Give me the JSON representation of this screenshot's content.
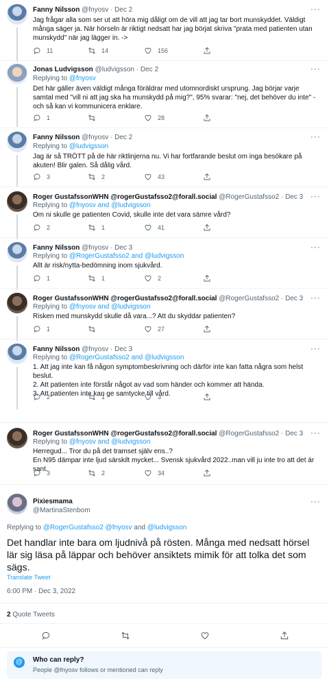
{
  "tweets": [
    {
      "name": "Fanny Nilsson",
      "handle": "@fnyosv",
      "date": "Dec 2",
      "replying": null,
      "text": "Jag frågar alla som ser ut att höra mig dåligt om de vill att jag tar bort munskyddet. Väldigt många säger ja. När hörseln är riktigt nedsatt har jag börjat skriva \"prata med patienten utan munskydd\" när jag lägger in. ->",
      "replies": "11",
      "retweets": "14",
      "likes": "156"
    },
    {
      "name": "Jonas Ludvigsson",
      "handle": "@ludvigsson",
      "date": "Dec 2",
      "replying": [
        "@fnyosv"
      ],
      "text": "Det här gäller även väldigt många föräldrar med utomnordiskt ursprung. Jag börjar varje samtal med \"vill ni att jag ska ha munskydd på mig?\", 95% svarar: \"nej, det behöver du inte\" - och så kan vi kommunicera enklare.",
      "replies": "1",
      "retweets": "",
      "likes": "28"
    },
    {
      "name": "Fanny Nilsson",
      "handle": "@fnyosv",
      "date": "Dec 2",
      "replying": [
        "@ludvigsson"
      ],
      "text": "Jag är så TRÖTT på de här riktlinjerna nu. Vi har fortfarande beslut om inga besökare på akuten! Blir galen. Så dålig vård.",
      "replies": "3",
      "retweets": "2",
      "likes": "43"
    },
    {
      "name": "Roger GustafssonWHN @rogerGustafsso2@forall.social",
      "handle": "@RogerGustafsso2",
      "date": "Dec 3",
      "replying": [
        "@fnyosv",
        "@ludvigsson"
      ],
      "text": "Om ni skulle ge patienten Covid, skulle inte det vara sämre vård?",
      "replies": "2",
      "retweets": "1",
      "likes": "41"
    },
    {
      "name": "Fanny Nilsson",
      "handle": "@fnyosv",
      "date": "Dec 3",
      "replying": [
        "@RogerGustafsso2",
        "@ludvigsson"
      ],
      "text": "Allt är risk/nytta-bedömning inom sjukvård.",
      "replies": "1",
      "retweets": "1",
      "likes": "2"
    },
    {
      "name": "Roger GustafssonWHN @rogerGustafsso2@forall.social",
      "handle": "@RogerGustafsso2",
      "date": "Dec 3",
      "replying": [
        "@fnyosv",
        "@ludvigsson"
      ],
      "text": "Risken med munskydd skulle då vara...? Att du skyddar patienten?",
      "replies": "1",
      "retweets": "",
      "likes": "27"
    },
    {
      "name": "Fanny Nilsson",
      "handle": "@fnyosv",
      "date": "Dec 3",
      "replying": [
        "@RogerGustafsso2",
        "@ludvigsson"
      ],
      "text_lines": [
        "1. Att jag inte kan få någon symptombeskrivning och därför inte kan fatta några som helst beslut.",
        "2. Att patienten inte förstår något av vad som händer och kommer att hända.",
        "3. Att patienten inte kan ge samtycke till vård."
      ],
      "replies": "2",
      "retweets": "1",
      "likes": "3"
    },
    {
      "name": "Roger GustafssonWHN @rogerGustafsso2@forall.social",
      "handle": "@RogerGustafsso2",
      "date": "Dec 3",
      "replying": [
        "@fnyosv",
        "@ludvigsson"
      ],
      "text_lines": [
        "Herregud... Tror du på det tramset själv ens..?",
        "En N95 dämpar inte ljud särskilt mycket... Svensk sjukvård 2022..man vill ju inte tro att det är sant."
      ],
      "replies": "3",
      "retweets": "2",
      "likes": "34"
    }
  ],
  "labels": {
    "replying_to": "Replying to",
    "and": "and",
    "dot": "·"
  },
  "focus": {
    "name": "Pixiesmama",
    "handle": "@MartinaStenbom",
    "replying_prefix": "Replying to",
    "replying_links": [
      "@RogerGustafsso2",
      "@fnyosv",
      "@ludvigsson"
    ],
    "replying_and": "and",
    "text": "Det handlar inte bara om ljudnivå på rösten. Många med nedsatt hörsel lär sig läsa på läppar och behöver ansiktets mimik för att tolka det som sägs.",
    "translate": "Translate Tweet",
    "timestamp": "6:00 PM · Dec 3, 2022",
    "quote_count": "2",
    "quote_label": "Quote Tweets"
  },
  "who_can_reply": {
    "title": "Who can reply?",
    "subtitle": "People @fnyosv follows or mentioned can reply"
  },
  "icons": {
    "reply": "reply-icon",
    "retweet": "retweet-icon",
    "like": "heart-icon",
    "share": "share-icon",
    "more": "more-icon",
    "who": "at-icon"
  },
  "colors": {
    "link": "#1d9bf0",
    "muted": "#536471",
    "text": "#0f1419",
    "box": "#f0f7fd"
  }
}
